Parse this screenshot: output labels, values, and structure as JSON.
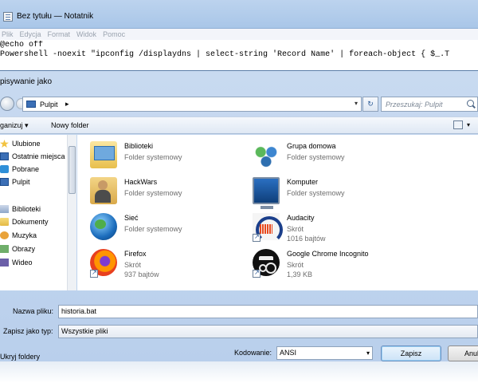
{
  "notepad": {
    "title": "Bez tytułu — Notatnik",
    "menu": [
      "Plik",
      "Edycja",
      "Format",
      "Widok",
      "Pomoc"
    ],
    "lines": [
      "@echo off",
      "Powershell -noexit \"ipconfig /displaydns | select-string 'Record Name' | foreach-object { $_.T"
    ]
  },
  "dialog": {
    "title": "pisywanie jako",
    "address": {
      "location": "Pulpit",
      "separator": "▸"
    },
    "search": {
      "placeholder": "Przeszukaj: Pulpit"
    },
    "toolbar": {
      "organize": "ganizuj ▾",
      "new_folder": "Nowy folder"
    },
    "nav": [
      {
        "label": "Ulubione",
        "icon": "star-icon"
      },
      {
        "label": "Ostatnie miejsca",
        "icon": "recent-places-icon"
      },
      {
        "label": "Pobrane",
        "icon": "downloads-icon"
      },
      {
        "label": "Pulpit",
        "icon": "desktop-icon"
      },
      {
        "label": "Biblioteki",
        "icon": "libraries-icon"
      },
      {
        "label": "Dokumenty",
        "icon": "documents-icon"
      },
      {
        "label": "Muzyka",
        "icon": "music-icon"
      },
      {
        "label": "Obrazy",
        "icon": "pictures-icon"
      },
      {
        "label": "Wideo",
        "icon": "video-icon"
      }
    ],
    "files": [
      {
        "name": "Biblioteki",
        "type": "Folder systemowy",
        "size": "",
        "icon": "libraries-folder-icon"
      },
      {
        "name": "Grupa domowa",
        "type": "Folder systemowy",
        "size": "",
        "icon": "homegroup-icon"
      },
      {
        "name": "HackWars",
        "type": "Folder systemowy",
        "size": "",
        "icon": "user-folder-icon"
      },
      {
        "name": "Komputer",
        "type": "Folder systemowy",
        "size": "",
        "icon": "computer-icon"
      },
      {
        "name": "Sieć",
        "type": "Folder systemowy",
        "size": "",
        "icon": "network-icon"
      },
      {
        "name": "Audacity",
        "type": "Skrót",
        "size": "1016 bajtów",
        "icon": "audacity-icon"
      },
      {
        "name": "Firefox",
        "type": "Skrót",
        "size": "937 bajtów",
        "icon": "firefox-icon"
      },
      {
        "name": "Google Chrome Incognito",
        "type": "Skrót",
        "size": "1,39 KB",
        "icon": "chrome-incognito-icon"
      }
    ],
    "filename": {
      "label": "Nazwa pliku:",
      "value": "historia.bat"
    },
    "filetype": {
      "label": "Zapisz jako typ:",
      "value": "Wszystkie pliki"
    },
    "hide_folders": "Ukryj foldery",
    "encoding": {
      "label": "Kodowanie:",
      "value": "ANSI"
    },
    "save_label": "Zapisz",
    "cancel_label": "Anul"
  }
}
